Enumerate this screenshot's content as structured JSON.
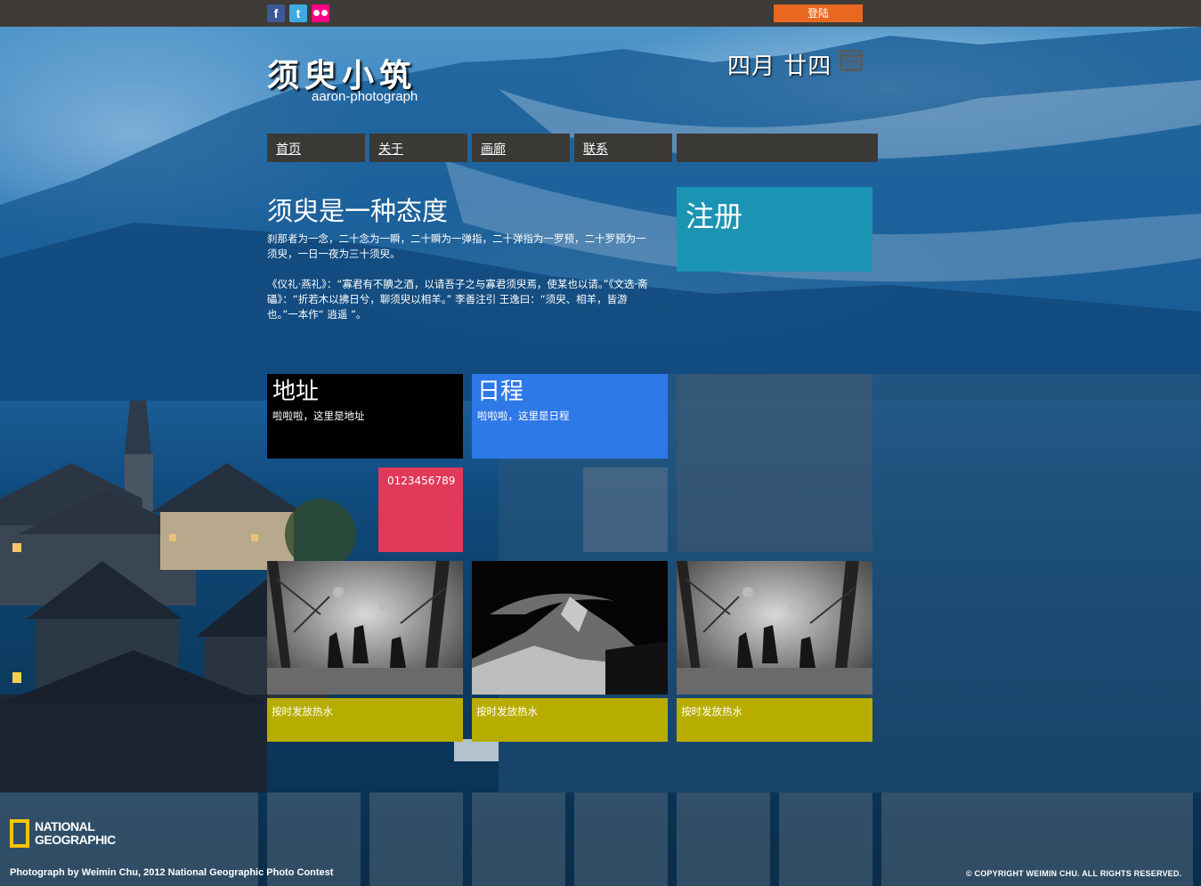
{
  "topbar": {
    "social_icons": [
      "facebook-icon",
      "twitter-icon",
      "flickr-icon"
    ],
    "social_glyphs": {
      "facebook": "f",
      "twitter": "t"
    },
    "login_label": "登陆"
  },
  "header": {
    "site_title": "须臾小筑",
    "site_subtitle": "aaron-photograph",
    "date": "四月 廿四",
    "calendar_icon": "calendar-icon"
  },
  "nav": {
    "items": [
      {
        "label": "首页"
      },
      {
        "label": "关于"
      },
      {
        "label": "画廊"
      },
      {
        "label": "联系"
      },
      {
        "label": ""
      }
    ]
  },
  "intro": {
    "title": "须臾是一种态度",
    "paragraph1": "刹那者为一念，二十念为一瞬，二十瞬为一弹指，二十弹指为一罗预，二十罗预为一须臾，一日一夜为三十须臾。",
    "paragraph2": "《仪礼·燕礼》：“寡君有不腆之酒，以请吾子之与寡君须臾焉，使某也以请。”《文选·斋礧》：“折若木以拂日兮，聊须臾以相羊。” 李善注引 王逸曰：“须臾、相羊，皆游也。”一本作“ 逍遥 ”。"
  },
  "tiles": {
    "register": {
      "title": "注册"
    },
    "address": {
      "title": "地址",
      "desc": "啦啦啦，这里是地址"
    },
    "schedule": {
      "title": "日程",
      "desc": "啦啦啦，这里是日程"
    },
    "phone": {
      "text": "0123456789"
    },
    "photos": [
      {
        "caption": "按时发放热水"
      },
      {
        "caption": "按时发放热水"
      },
      {
        "caption": "按时发放热水"
      }
    ]
  },
  "footer": {
    "logo_line1": "NATIONAL",
    "logo_line2": "GEOGRAPHIC",
    "credit": "Photograph by Weimin Chu, 2012 National Geographic Photo Contest",
    "copyright": "© COPYRIGHT WEIMIN CHU.  ALL RIGHTS RESERVED."
  },
  "colors": {
    "topbar": "#3f3c38",
    "login": "#e8681f",
    "nav": "#3b3935",
    "register_tile": "#1b94b4",
    "address_tile": "#000000",
    "schedule_tile": "#2e79e8",
    "phone_tile": "#e0395a",
    "caption_tile": "#b7ad00"
  }
}
